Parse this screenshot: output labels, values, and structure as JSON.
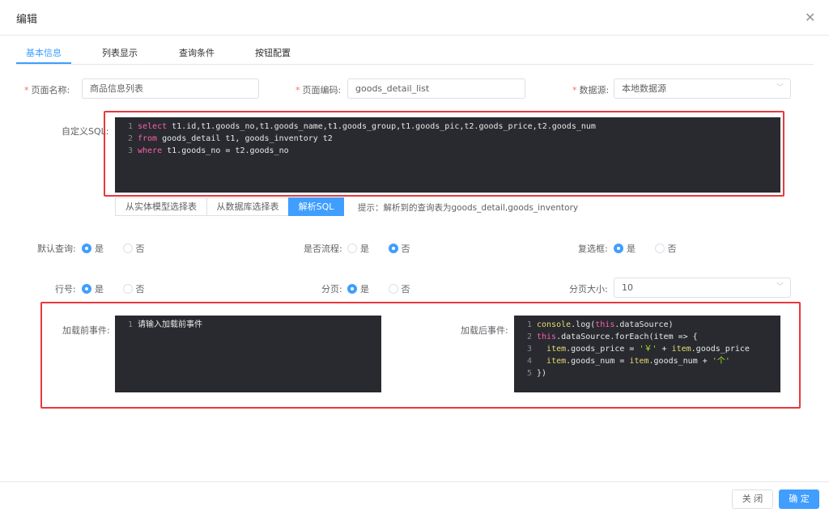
{
  "dialog": {
    "title": "编辑",
    "close_icon": "close-icon"
  },
  "tabs": [
    "基本信息",
    "列表显示",
    "查询条件",
    "按钮配置"
  ],
  "form": {
    "page_name": {
      "label": "页面名称",
      "value": "商品信息列表"
    },
    "page_code": {
      "label": "页面编码",
      "value": "goods_detail_list"
    },
    "datasource": {
      "label": "数据源",
      "value": "本地数据源"
    },
    "sql_label": "自定义SQL",
    "sql_lines": [
      {
        "n": "1",
        "parts": [
          [
            "kw",
            "select"
          ],
          [
            "plain",
            " t1.id,t1.goods_no,t1.goods_name,t1.goods_group,t1.goods_pic,t2.goods_price,t2.goods_num"
          ]
        ]
      },
      {
        "n": "2",
        "parts": [
          [
            "kw",
            "from"
          ],
          [
            "plain",
            " goods_detail t1, goods_inventory t2"
          ]
        ]
      },
      {
        "n": "3",
        "parts": [
          [
            "kw",
            "where"
          ],
          [
            "plain",
            " t1.goods_no = t2.goods_no"
          ]
        ]
      }
    ],
    "sql_buttons": [
      "从实体模型选择表",
      "从数据库选择表",
      "解析SQL"
    ],
    "sql_hint": "提示：解析到的查询表为goods_detail,goods_inventory",
    "default_query": {
      "label": "默认查询",
      "yes": "是",
      "no": "否",
      "selected": "yes"
    },
    "is_flow": {
      "label": "是否流程",
      "yes": "是",
      "no": "否",
      "selected": "no"
    },
    "multi_select": {
      "label": "复选框",
      "yes": "是",
      "no": "否",
      "selected": "yes"
    },
    "row_no": {
      "label": "行号",
      "yes": "是",
      "no": "否",
      "selected": "yes"
    },
    "paging": {
      "label": "分页",
      "yes": "是",
      "no": "否",
      "selected": "yes"
    },
    "page_size": {
      "label": "分页大小",
      "value": "10"
    },
    "before_load": {
      "label": "加载前事件",
      "lines": [
        {
          "n": "1",
          "parts": [
            [
              "plain",
              "请输入加载前事件"
            ]
          ]
        }
      ]
    },
    "after_load": {
      "label": "加载后事件",
      "lines": [
        {
          "n": "1",
          "parts": [
            [
              "ident",
              "console"
            ],
            [
              "plain",
              ".log("
            ],
            [
              "kw",
              "this"
            ],
            [
              "plain",
              ".dataSource)"
            ]
          ]
        },
        {
          "n": "2",
          "parts": [
            [
              "kw",
              "this"
            ],
            [
              "plain",
              ".dataSource.forEach(item => {"
            ]
          ]
        },
        {
          "n": "3",
          "parts": [
            [
              "plain",
              "  "
            ],
            [
              "ident",
              "item"
            ],
            [
              "plain",
              ".goods_price = "
            ],
            [
              "str",
              "'￥'"
            ],
            [
              "plain",
              " + "
            ],
            [
              "ident",
              "item"
            ],
            [
              "plain",
              ".goods_price"
            ]
          ]
        },
        {
          "n": "4",
          "parts": [
            [
              "plain",
              "  "
            ],
            [
              "ident",
              "item"
            ],
            [
              "plain",
              ".goods_num = "
            ],
            [
              "ident",
              "item"
            ],
            [
              "plain",
              ".goods_num + "
            ],
            [
              "str",
              "'个'"
            ]
          ]
        },
        {
          "n": "5",
          "parts": [
            [
              "plain",
              "})"
            ]
          ]
        }
      ]
    }
  },
  "footer": {
    "cancel": "关 闭",
    "confirm": "确 定"
  },
  "colors": {
    "accent": "#409eff",
    "highlight_box": "#e8383d",
    "editor_bg": "#282a2f"
  }
}
